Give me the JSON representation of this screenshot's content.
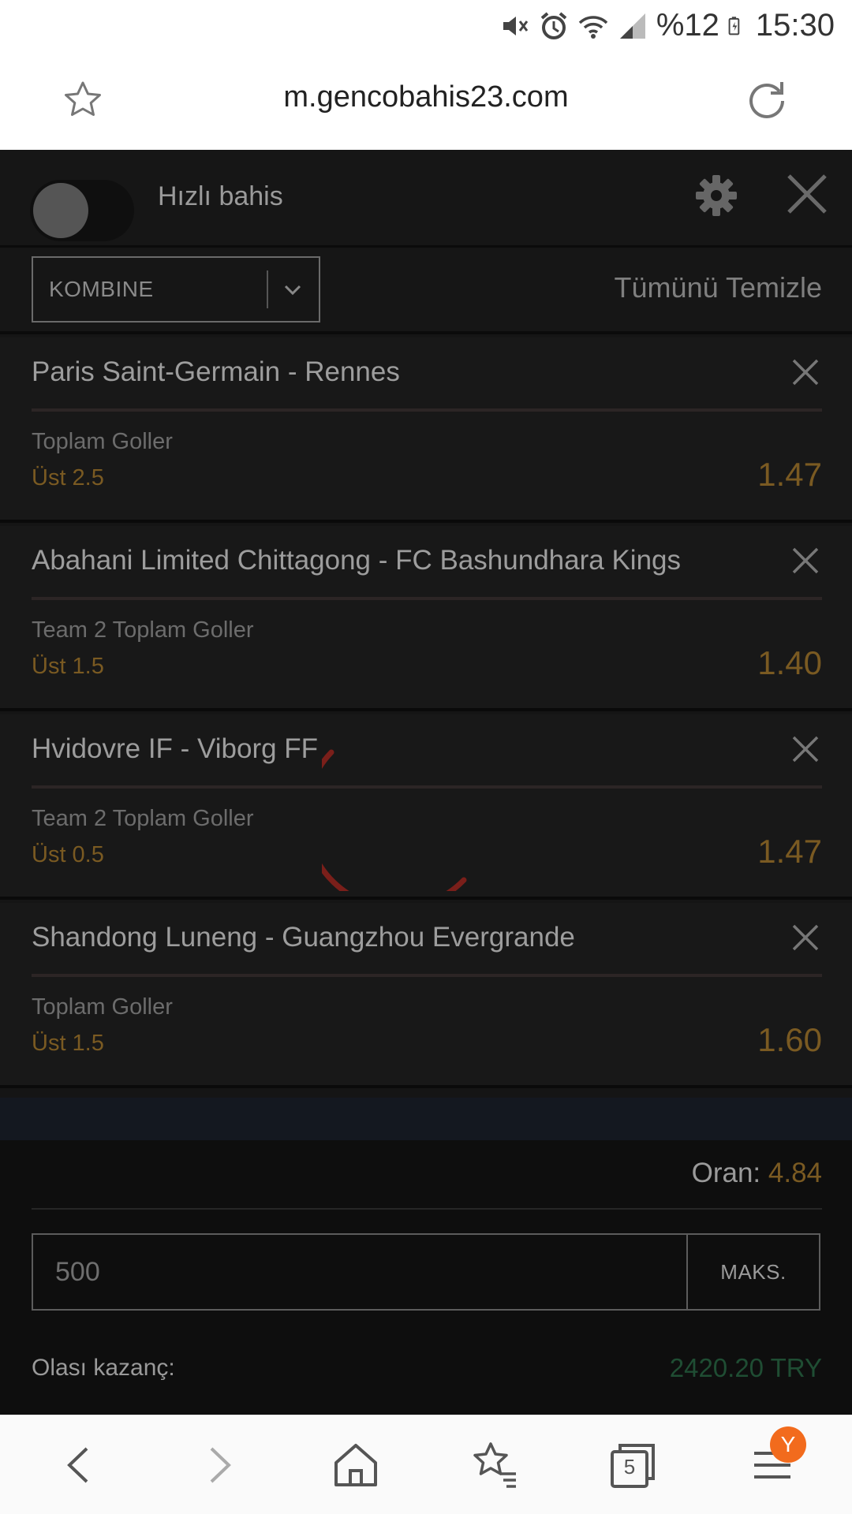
{
  "status_bar": {
    "battery": "%12",
    "time": "15:30"
  },
  "browser": {
    "url": "m.gencobahis23.com",
    "tab_count": "5",
    "menu_badge": "Y"
  },
  "betslip": {
    "quick_bet_label": "Hızlı bahis",
    "bet_type": "KOMBINE",
    "clear_all": "Tümünü Temizle",
    "bets": [
      {
        "match": "Paris Saint-Germain - Rennes",
        "market": "Toplam Goller",
        "selection": "Üst 2.5",
        "odd": "1.47"
      },
      {
        "match": "Abahani Limited Chittagong - FC Bashundhara Kings",
        "market": "Team 2 Toplam Goller",
        "selection": "Üst 1.5",
        "odd": "1.40"
      },
      {
        "match": "Hvidovre IF - Viborg FF",
        "market": "Team 2 Toplam Goller",
        "selection": "Üst 0.5",
        "odd": "1.47"
      },
      {
        "match": "Shandong Luneng - Guangzhou Evergrande",
        "market": "Toplam Goller",
        "selection": "Üst 1.5",
        "odd": "1.60"
      }
    ],
    "total_odds_label": "Oran:",
    "total_odds": "4.84",
    "stake": "500",
    "max_label": "MAKS.",
    "possible_win_label": "Olası kazanç:",
    "possible_win": "2420.20 TRY"
  },
  "colors": {
    "odds": "#7a5a22",
    "win": "#1f4d33",
    "badge": "#f26b1d"
  }
}
